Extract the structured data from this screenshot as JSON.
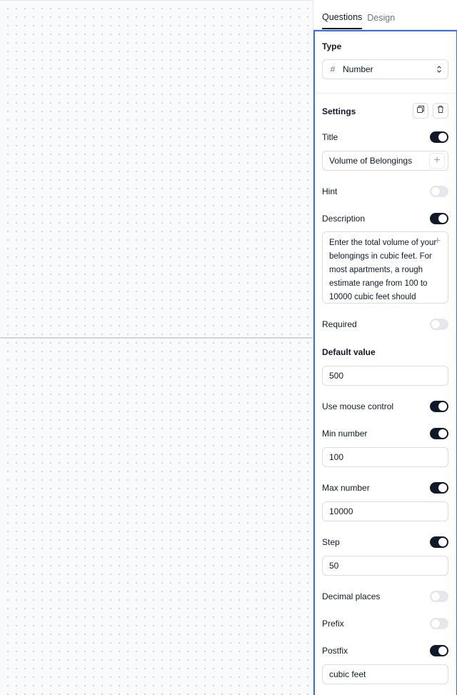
{
  "tabs": [
    {
      "label": "Questions",
      "active": true
    },
    {
      "label": "Design",
      "active": false
    }
  ],
  "type_section": {
    "title": "Type",
    "value": "Number",
    "icon": "hash-icon"
  },
  "settings": {
    "title": "Settings",
    "title_toggle": {
      "label": "Title",
      "on": true,
      "value": "Volume of Belongings"
    },
    "hint_toggle": {
      "label": "Hint",
      "on": false
    },
    "description_toggle": {
      "label": "Description",
      "on": true,
      "value": "Enter the total volume of your belongings in cubic feet. For most apartments, a rough estimate range from 100 to 10000 cubic feet should"
    },
    "required_toggle": {
      "label": "Required",
      "on": false
    }
  },
  "number_settings": {
    "default_value": {
      "label": "Default value",
      "value": "500"
    },
    "mouse_control": {
      "label": "Use mouse control",
      "on": true
    },
    "min_number": {
      "label": "Min number",
      "on": true,
      "value": "100"
    },
    "max_number": {
      "label": "Max number",
      "on": true,
      "value": "10000"
    },
    "step": {
      "label": "Step",
      "on": true,
      "value": "50"
    },
    "decimal_places": {
      "label": "Decimal places",
      "on": false
    },
    "prefix": {
      "label": "Prefix",
      "on": false
    },
    "postfix": {
      "label": "Postfix",
      "on": true,
      "value": "cubic feet"
    }
  },
  "colors": {
    "accent": "#3b6fe0",
    "toggle_on": "#111827",
    "toggle_off": "#e5e7eb"
  }
}
